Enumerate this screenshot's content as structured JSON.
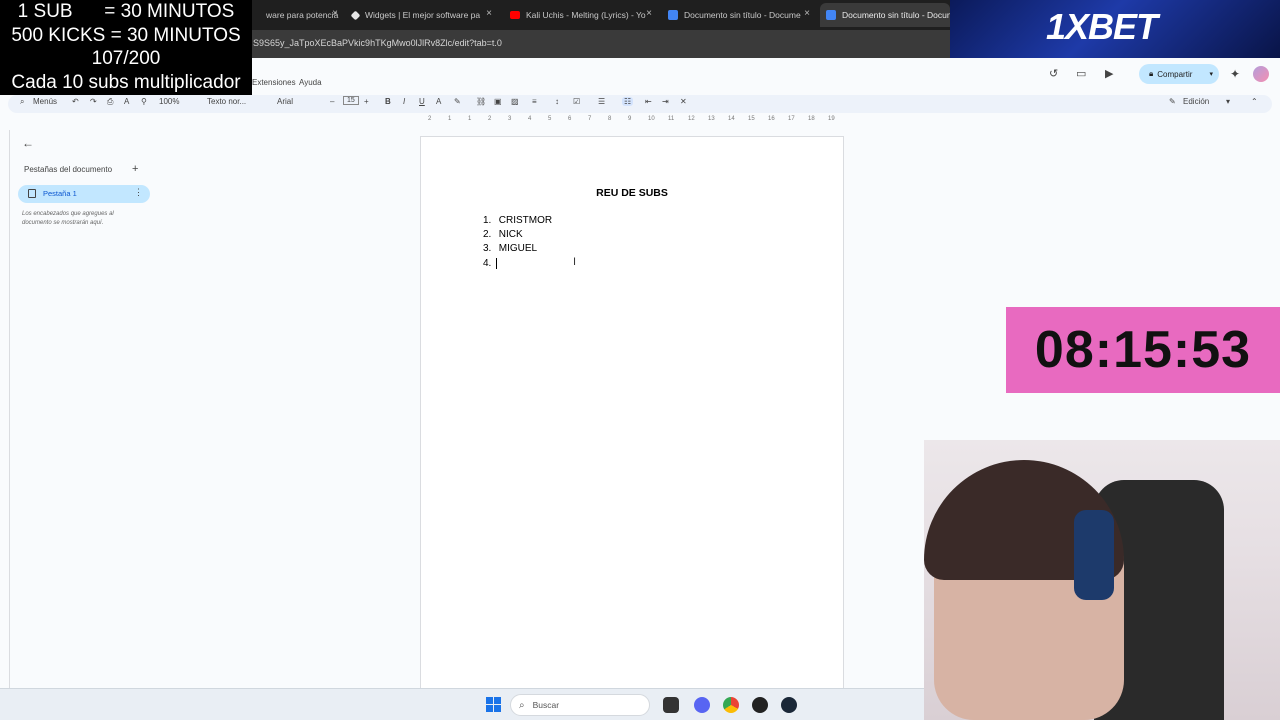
{
  "browser": {
    "tabs": [
      {
        "title": "ware para potenciá",
        "icon": "streamlabs-icon"
      },
      {
        "title": "Widgets | El mejor software pa",
        "icon": "widgets-icon"
      },
      {
        "title": "Kali Uchis - Melting (Lyrics) - Yo",
        "icon": "youtube-icon"
      },
      {
        "title": "Documento sin título - Docume",
        "icon": "google-docs-icon"
      },
      {
        "title": "Documento sin título - Docum",
        "icon": "google-docs-icon"
      }
    ],
    "close_glyph": "×",
    "url": "S9S65y_JaTpoXEcBaPVkic9hTKgMwo0lJlRv8Zlc/edit?tab=t.0"
  },
  "docs": {
    "menu": [
      "Extensiones",
      "Ayuda"
    ],
    "share_label": "Compartir",
    "mode_label": "Edición",
    "toolbar": {
      "menus_label": "Menús",
      "zoom": "100%",
      "style": "Texto nor...",
      "font": "Arial",
      "font_size": "15",
      "minus": "–",
      "plus": "+"
    },
    "ruler_ticks": [
      "2",
      "1",
      "1",
      "2",
      "3",
      "4",
      "5",
      "6",
      "7",
      "8",
      "9",
      "10",
      "11",
      "12",
      "13",
      "14",
      "15",
      "16",
      "17",
      "18",
      "19"
    ]
  },
  "sidebar": {
    "title": "Pestañas del documento",
    "add_glyph": "+",
    "tab_label": "Pestaña 1",
    "help_text": "Los encabezados que agregues al documento se mostrarán aquí."
  },
  "document": {
    "title": "REU DE SUBS",
    "items": [
      {
        "num": "1.",
        "text": "CRISTMOR"
      },
      {
        "num": "2.",
        "text": "NICK"
      },
      {
        "num": "3.",
        "text": "MIGUEL"
      },
      {
        "num": "4.",
        "text": ""
      }
    ]
  },
  "overlay": {
    "lines": [
      "1 SUB      = 30 MINUTOS",
      "500 KICKS = 30 MINUTOS",
      "107/200",
      "Cada 10 subs multiplicador"
    ]
  },
  "sponsor": {
    "logo_text": "1XBET"
  },
  "timer": {
    "value": "08:15:53"
  },
  "taskbar": {
    "search_placeholder": "Buscar"
  },
  "colors": {
    "timer_bg": "#e86ac0",
    "share_bg": "#c2e7ff",
    "sponsor_bg": "#1e3aa8",
    "overlay_bg": "#000000"
  }
}
